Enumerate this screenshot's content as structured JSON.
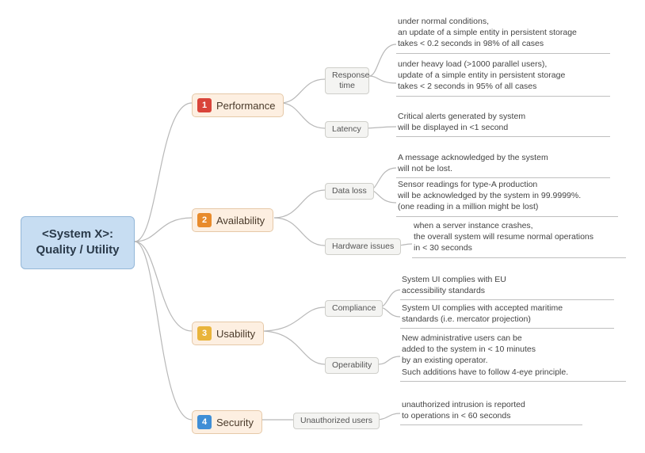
{
  "root": {
    "label": "<System X>:\nQuality / Utility"
  },
  "categories": [
    {
      "num": "1",
      "label": "Performance",
      "subs": [
        {
          "label": "Response\ntime",
          "leaves": [
            "under normal conditions,\nan update of a simple entity in persistent storage\ntakes < 0.2 seconds in 98% of all cases",
            "under heavy load (>1000 parallel users),\nupdate of a simple entity in persistent storage\ntakes < 2 seconds in 95% of all cases"
          ]
        },
        {
          "label": "Latency",
          "leaves": [
            "Critical alerts generated by system\nwill be displayed in <1 second"
          ]
        }
      ]
    },
    {
      "num": "2",
      "label": "Availability",
      "subs": [
        {
          "label": "Data loss",
          "leaves": [
            "A message acknowledged by the system\nwill not be lost.",
            "Sensor readings for type-A production\nwill be acknowledged by the system in 99.9999%.\n(one reading in a million might be lost)"
          ]
        },
        {
          "label": "Hardware issues",
          "leaves": [
            "when a server instance crashes,\nthe overall system will resume normal operations\nin < 30 seconds"
          ]
        }
      ]
    },
    {
      "num": "3",
      "label": "Usability",
      "subs": [
        {
          "label": "Compliance",
          "leaves": [
            "System UI complies with EU\naccessibility standards",
            "System UI complies with accepted maritime\nstandards (i.e. mercator projection)"
          ]
        },
        {
          "label": "Operability",
          "leaves": [
            "New administrative users can be\nadded to the system in < 10 minutes\nby an existing operator.\nSuch additions have to follow 4-eye principle."
          ]
        }
      ]
    },
    {
      "num": "4",
      "label": "Security",
      "subs": [
        {
          "label": "Unauthorized users",
          "leaves": [
            "unauthorized intrusion is reported\nto operations in < 60 seconds"
          ]
        }
      ]
    }
  ]
}
